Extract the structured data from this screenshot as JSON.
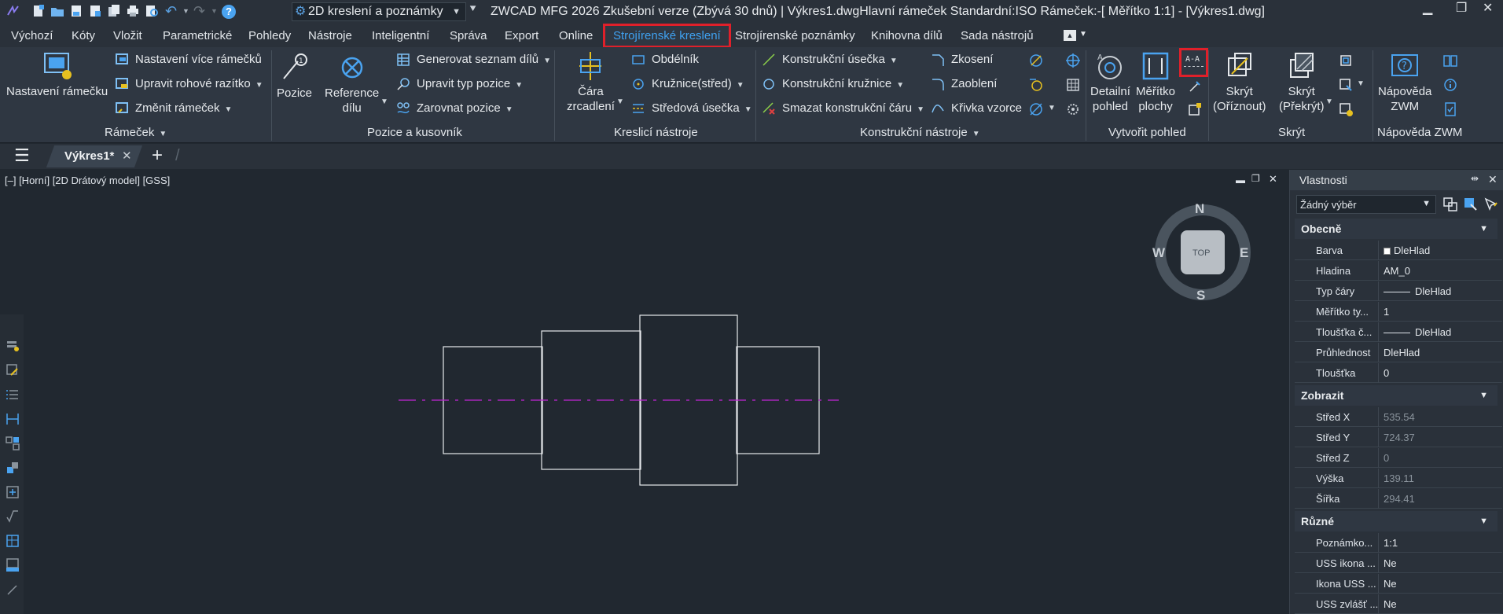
{
  "titlebar": {
    "workspace": "2D kreslení a poznámky",
    "title": "ZWCAD MFG 2026 Zkušební verze (Zbývá 30 dnů) | Výkres1.dwgHlavní rámeček  Standardní:ISO Rámeček:-[ Měřítko 1:1] - [Výkres1.dwg]"
  },
  "menu": {
    "tabs": [
      "Výchozí",
      "Kóty",
      "Vložit",
      "Parametrické",
      "Pohledy",
      "Nástroje",
      "Inteligentní",
      "Správa",
      "Export",
      "Online",
      "Strojírenské kreslení",
      "Strojírenské poznámky",
      "Knihovna dílů",
      "Sada nástrojů"
    ],
    "active": "Strojírenské kreslení"
  },
  "ribbon": {
    "ramecek": {
      "nastaveni": "Nastavení rámečku",
      "vice": "Nastavení více rámečků",
      "razitko": "Upravit rohové razítko",
      "zmenit": "Změnit rámeček",
      "label": "Rámeček"
    },
    "pozice": {
      "pozice": "Pozice",
      "reference_1": "Reference",
      "reference_2": "dílu",
      "generovat": "Generovat seznam dílů",
      "upravit_typ": "Upravit typ pozice",
      "zarovnat": "Zarovnat pozice",
      "label": "Pozice a kusovník"
    },
    "kreslici": {
      "cara_1": "Čára",
      "cara_2": "zrcadlení",
      "obdelnik": "Obdélník",
      "kruznice": "Kružnice(střed)",
      "stredova": "Středová úsečka",
      "label": "Kreslicí nástroje"
    },
    "konstrukcni": {
      "usecka": "Konstrukční úsečka",
      "kruznice": "Konstrukční kružnice",
      "smazat": "Smazat konstrukční čáru",
      "zkoseni": "Zkosení",
      "zaobleni": "Zaoblení",
      "krivka": "Křivka vzorce",
      "label": "Konstrukční nástroje"
    },
    "pohled": {
      "detail_1": "Detailní",
      "detail_2": "pohled",
      "meritko_1": "Měřítko",
      "meritko_2": "plochy",
      "section_icon": "A-A",
      "label": "Vytvořit pohled"
    },
    "skryt": {
      "oriznout_1": "Skrýt",
      "oriznout_2": "(Oříznout)",
      "prekryt_1": "Skrýt",
      "prekryt_2": "(Překrýt)",
      "label": "Skrýt"
    },
    "napoveda": {
      "btn_1": "Nápověda",
      "btn_2": "ZWM",
      "label": "Nápověda ZWM"
    }
  },
  "doctab": {
    "name": "Výkres1*"
  },
  "viewport": {
    "label": "[–] [Horní] [2D Drátový model] [GSS]",
    "compass": {
      "n": "N",
      "s": "S",
      "e": "E",
      "w": "W",
      "top": "TOP"
    }
  },
  "properties": {
    "title": "Vlastnosti",
    "selection": "Žádný výběr",
    "sections": [
      {
        "name": "Obecně",
        "rows": [
          {
            "k": "Barva",
            "v": "DleHlad"
          },
          {
            "k": "Hladina",
            "v": "AM_0"
          },
          {
            "k": "Typ čáry",
            "v": "DleHlad"
          },
          {
            "k": "Měřítko ty...",
            "v": "1"
          },
          {
            "k": "Tloušťka č...",
            "v": "DleHlad"
          },
          {
            "k": "Průhlednost",
            "v": "DleHlad"
          },
          {
            "k": "Tloušťka",
            "v": "0"
          }
        ]
      },
      {
        "name": "Zobrazit",
        "rows": [
          {
            "k": "Střed X",
            "v": "535.54"
          },
          {
            "k": "Střed Y",
            "v": "724.37"
          },
          {
            "k": "Střed Z",
            "v": "0"
          },
          {
            "k": "Výška",
            "v": "139.11"
          },
          {
            "k": "Šířka",
            "v": "294.41"
          }
        ]
      },
      {
        "name": "Různé",
        "rows": [
          {
            "k": "Poznámko...",
            "v": "1:1"
          },
          {
            "k": "USS ikona ...",
            "v": "Ne"
          },
          {
            "k": "Ikona USS ...",
            "v": "Ne"
          },
          {
            "k": "USS zvlášť ...",
            "v": "Ne"
          }
        ]
      }
    ]
  },
  "colors": {
    "accent": "#3fa1f0",
    "highlight": "#e0202a",
    "centerline": "#c026d3"
  }
}
